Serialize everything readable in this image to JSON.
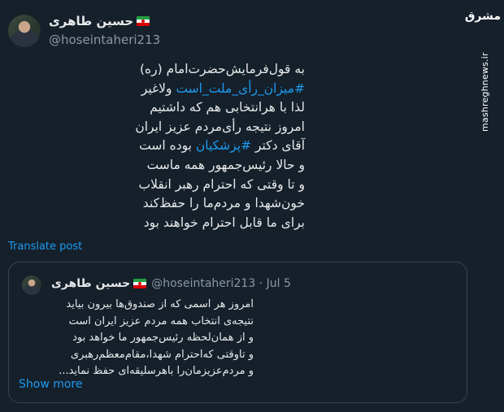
{
  "post": {
    "display_name": "حسین طاهری",
    "handle": "@hoseintaheri213",
    "lines": [
      [
        {
          "t": "به قول‌فرمایش‌حضرت‌امام (ره)"
        }
      ],
      [
        {
          "t": "#میزان_رأی_ملت_است",
          "tag": true
        },
        {
          "t": " ولاغیر"
        }
      ],
      [
        {
          "t": "لذا با هرانتخابی هم که داشتیم"
        }
      ],
      [
        {
          "t": "امروز نتیجه رأی‌مردم عزیز ایران"
        }
      ],
      [
        {
          "t": "آقای دکتر "
        },
        {
          "t": "#پزشکیان",
          "tag": true
        },
        {
          "t": " بوده است"
        }
      ],
      [
        {
          "t": "و حالا رئیس‌جمهور همه ماست"
        }
      ],
      [
        {
          "t": "و تا وقتی که احترام رهبر انقلاب"
        }
      ],
      [
        {
          "t": "خون‌شهدا و مردم‌ما را حفظ‌کند"
        }
      ],
      [
        {
          "t": "برای ما قابل احترام خواهند بود"
        }
      ]
    ],
    "translate_label": "Translate post",
    "hashtag_color": "#1d9bf0"
  },
  "quote": {
    "display_name": "حسین طاهری",
    "meta": "@hoseintaheri213 · Jul 5",
    "lines": [
      "امروز هر اسمی که از صندوق‌ها بیرون بیاید",
      "نتیجه‌ی انتخاب  همه مردم عزیز ایران است",
      "و از همان‌لحظه رئیس‌جمهور ما خواهد بود",
      "و تاوقتی که‌احترام شهدا،مقام‌معظم‌رهبری",
      "و مردم‌عزیزمان‌را باهرسلیقه‌ای حفظ نماید..."
    ],
    "show_more_label": "Show more"
  },
  "watermark": {
    "logo_text": "مشرق",
    "site": "mashreghnews.ir"
  }
}
